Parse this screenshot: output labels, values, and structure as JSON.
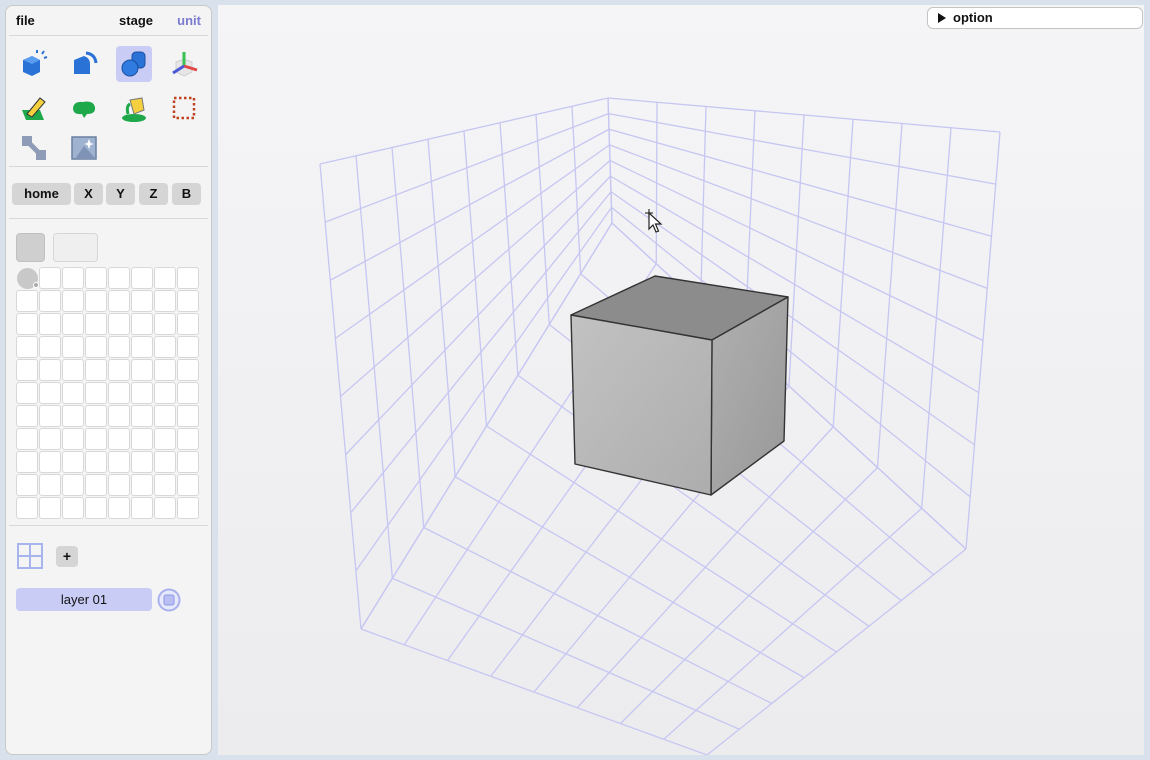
{
  "menubar": {
    "file": "file",
    "stage": "stage",
    "unit": "unit"
  },
  "tools": [
    {
      "name": "add-cube-tool",
      "icon": "cube-sparkle-icon",
      "active": false
    },
    {
      "name": "bend-tool",
      "icon": "bend-shape-icon",
      "active": false
    },
    {
      "name": "shapes-tool",
      "icon": "shapes-icon",
      "active": true
    },
    {
      "name": "transform-tool",
      "icon": "axes-gizmo-icon",
      "active": false
    },
    {
      "name": "paint-tool",
      "icon": "pencil-paint-icon",
      "active": false
    },
    {
      "name": "fill-tool",
      "icon": "blob-icon",
      "active": false
    },
    {
      "name": "bucket-tool",
      "icon": "paint-bucket-icon",
      "active": false
    },
    {
      "name": "select-tool",
      "icon": "marquee-select-icon",
      "active": false
    },
    {
      "name": "move-tool",
      "icon": "move-diagonal-icon",
      "active": false
    },
    {
      "name": "frame-tool",
      "icon": "frame-sparkle-icon",
      "active": false
    }
  ],
  "view_buttons": [
    "home",
    "X",
    "Y",
    "Z",
    "B"
  ],
  "palette": {
    "columns": 8,
    "rows": 11
  },
  "layers": {
    "add_label": "+",
    "items": [
      {
        "label": "layer 01"
      }
    ]
  },
  "viewport": {
    "option_label": "option"
  },
  "colors": {
    "accent": "#c9cdf5",
    "grid_line": "#c6c6f2",
    "cube_front": "#b8b8b8",
    "cube_top": "#8c8c8c",
    "cube_side": "#a6a6a6"
  }
}
